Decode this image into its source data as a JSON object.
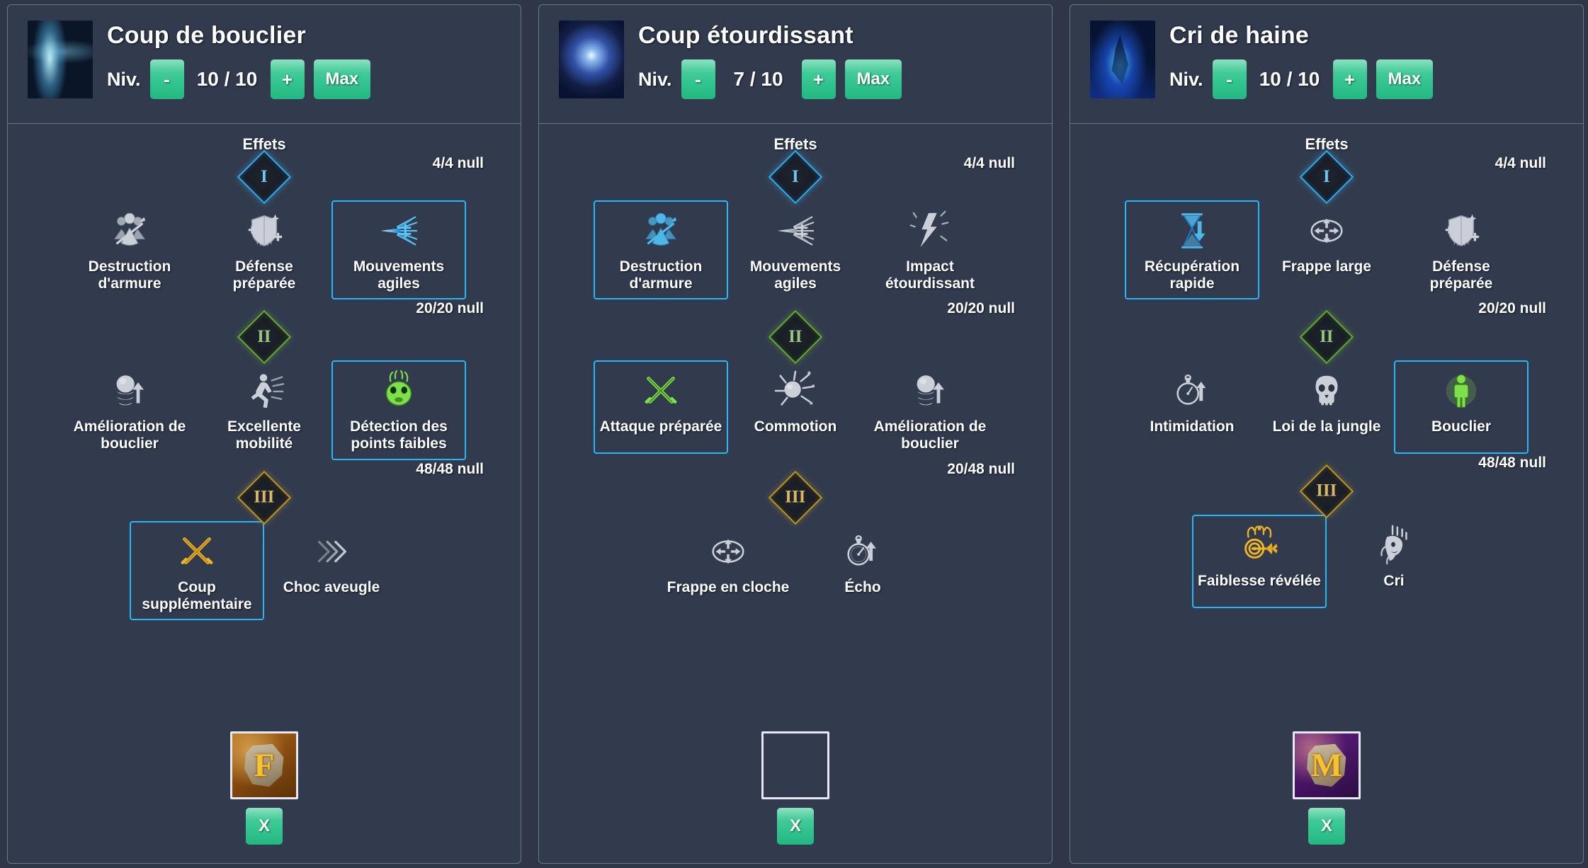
{
  "ui": {
    "effects_label": "Effets",
    "level_label": "Niv.",
    "minus_label": "-",
    "plus_label": "+",
    "max_label": "Max",
    "remove_label": "X",
    "tier_1": "I",
    "tier_2": "II",
    "tier_3": "III"
  },
  "colors": {
    "background": "#2e3647",
    "panel": "#323b4e",
    "panel_border": "#6d7588",
    "accent_green": "#22b882",
    "selected_border": "#29b6f6",
    "tier1": "#35a8e8",
    "tier2": "#64a832",
    "tier3": "#b99526",
    "text": "#ffffff"
  },
  "panels": [
    {
      "id": "coup-de-bouclier",
      "title": "Coup de bouclier",
      "portrait": "shield-bash-portrait",
      "level_current": "10",
      "level_max": "10",
      "level_display": "10 / 10",
      "counters": {
        "tier1": "4/4 null",
        "tier2": "20/20 null",
        "tier3": "48/48 null"
      },
      "rows": [
        {
          "tier": "I",
          "nodes": [
            {
              "label": "Destruction d'armure",
              "icon": "armor-break-icon",
              "selected": false
            },
            {
              "label": "Défense préparée",
              "icon": "prepared-defense-icon",
              "selected": false
            },
            {
              "label": "Mouvements agiles",
              "icon": "agile-movements-icon",
              "selected": true
            }
          ]
        },
        {
          "tier": "II",
          "nodes": [
            {
              "label": "Amélioration de bouclier",
              "icon": "shield-upgrade-icon",
              "selected": false
            },
            {
              "label": "Excellente mobilité",
              "icon": "mobility-icon",
              "selected": false
            },
            {
              "label": "Détection des points faibles",
              "icon": "weakpoint-detection-icon",
              "selected": true
            }
          ]
        },
        {
          "tier": "III",
          "nodes": [
            {
              "label": "Coup supplémentaire",
              "icon": "extra-strike-icon",
              "selected": true
            },
            {
              "label": "Choc aveugle",
              "icon": "blind-shock-icon",
              "selected": false
            }
          ]
        }
      ],
      "rune": {
        "state": "filled",
        "glyph": "F",
        "style": "orange"
      }
    },
    {
      "id": "coup-etourdissant",
      "title": "Coup étourdissant",
      "portrait": "stunning-blow-portrait",
      "level_current": "7",
      "level_max": "10",
      "level_display": "7 / 10",
      "counters": {
        "tier1": "4/4 null",
        "tier2": "20/20 null",
        "tier3": "20/48 null"
      },
      "rows": [
        {
          "tier": "I",
          "nodes": [
            {
              "label": "Destruction d'armure",
              "icon": "armor-break-icon",
              "selected": true
            },
            {
              "label": "Mouvements agiles",
              "icon": "agile-movements-icon",
              "selected": false
            },
            {
              "label": "Impact étourdissant",
              "icon": "stunning-impact-icon",
              "selected": false
            }
          ]
        },
        {
          "tier": "II",
          "nodes": [
            {
              "label": "Attaque préparée",
              "icon": "prepared-attack-icon",
              "selected": true
            },
            {
              "label": "Commotion",
              "icon": "concussion-icon",
              "selected": false
            },
            {
              "label": "Amélioration de bouclier",
              "icon": "shield-upgrade-icon",
              "selected": false
            }
          ]
        },
        {
          "tier": "III",
          "nodes": [
            {
              "label": "Frappe en cloche",
              "icon": "bell-strike-icon",
              "selected": false
            },
            {
              "label": "Écho",
              "icon": "echo-icon",
              "selected": false
            }
          ]
        }
      ],
      "rune": {
        "state": "empty",
        "glyph": "",
        "style": "empty"
      }
    },
    {
      "id": "cri-de-haine",
      "title": "Cri de haine",
      "portrait": "hate-cry-portrait",
      "level_current": "10",
      "level_max": "10",
      "level_display": "10 / 10",
      "counters": {
        "tier1": "4/4 null",
        "tier2": "20/20 null",
        "tier3": "48/48 null"
      },
      "rows": [
        {
          "tier": "I",
          "nodes": [
            {
              "label": "Récupération rapide",
              "icon": "fast-recovery-icon",
              "selected": true
            },
            {
              "label": "Frappe large",
              "icon": "wide-strike-icon",
              "selected": false
            },
            {
              "label": "Défense préparée",
              "icon": "prepared-defense-icon",
              "selected": false
            }
          ]
        },
        {
          "tier": "II",
          "nodes": [
            {
              "label": "Intimidation",
              "icon": "intimidation-icon",
              "selected": false
            },
            {
              "label": "Loi de la jungle",
              "icon": "jungle-law-icon",
              "selected": false
            },
            {
              "label": "Bouclier",
              "icon": "shield-icon",
              "selected": true
            }
          ]
        },
        {
          "tier": "III",
          "nodes": [
            {
              "label": "Faiblesse révélée",
              "icon": "revealed-weakness-icon",
              "selected": true
            },
            {
              "label": "Cri",
              "icon": "cry-icon",
              "selected": false
            }
          ]
        }
      ],
      "rune": {
        "state": "filled",
        "glyph": "M",
        "style": "purple"
      }
    }
  ]
}
